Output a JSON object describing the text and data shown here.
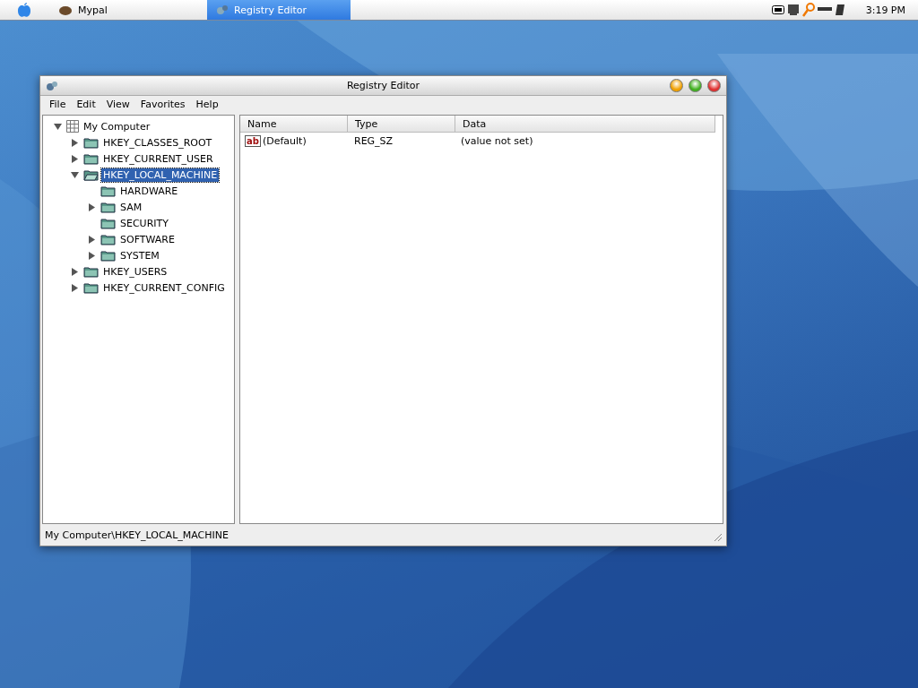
{
  "top_bar": {
    "tasks": [
      {
        "label": "Mypal",
        "selected": false
      },
      {
        "label": "Registry Editor",
        "selected": true
      }
    ],
    "clock": "3:19 PM"
  },
  "window": {
    "title": "Registry Editor"
  },
  "menu": [
    "File",
    "Edit",
    "View",
    "Favorites",
    "Help"
  ],
  "tree": [
    {
      "label": "My Computer",
      "kind": "computer",
      "expandable": true,
      "expanded": true,
      "selected": false,
      "children": [
        {
          "label": "HKEY_CLASSES_ROOT",
          "kind": "folder",
          "expandable": true,
          "expanded": false,
          "selected": false
        },
        {
          "label": "HKEY_CURRENT_USER",
          "kind": "folder",
          "expandable": true,
          "expanded": false,
          "selected": false
        },
        {
          "label": "HKEY_LOCAL_MACHINE",
          "kind": "folder",
          "expandable": true,
          "expanded": true,
          "selected": true,
          "children": [
            {
              "label": "HARDWARE",
              "kind": "folder",
              "expandable": false,
              "selected": false
            },
            {
              "label": "SAM",
              "kind": "folder",
              "expandable": true,
              "expanded": false,
              "selected": false
            },
            {
              "label": "SECURITY",
              "kind": "folder",
              "expandable": false,
              "selected": false
            },
            {
              "label": "SOFTWARE",
              "kind": "folder",
              "expandable": true,
              "expanded": false,
              "selected": false
            },
            {
              "label": "SYSTEM",
              "kind": "folder",
              "expandable": true,
              "expanded": false,
              "selected": false
            }
          ]
        },
        {
          "label": "HKEY_USERS",
          "kind": "folder",
          "expandable": true,
          "expanded": false,
          "selected": false
        },
        {
          "label": "HKEY_CURRENT_CONFIG",
          "kind": "folder",
          "expandable": true,
          "expanded": false,
          "selected": false
        }
      ]
    }
  ],
  "table": {
    "columns": [
      "Name",
      "Type",
      "Data"
    ],
    "rows": [
      {
        "icon_text": "ab",
        "name": "(Default)",
        "type": "REG_SZ",
        "data": "(value not set)"
      }
    ]
  },
  "status_bar": "My Computer\\HKEY_LOCAL_MACHINE"
}
